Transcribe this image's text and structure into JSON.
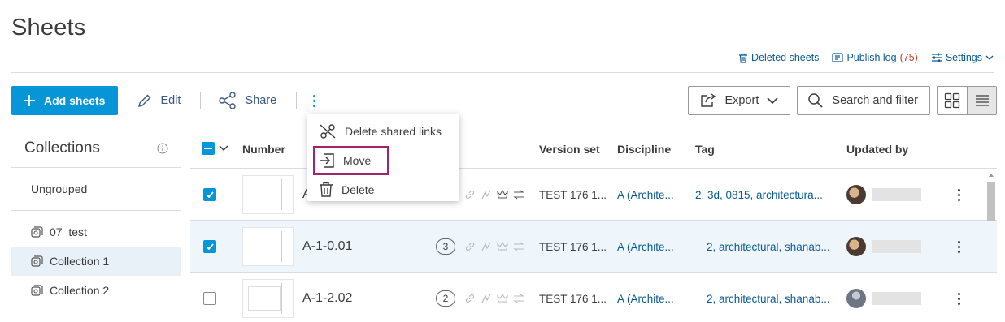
{
  "page_title": "Sheets",
  "top_links": {
    "deleted_sheets": "Deleted sheets",
    "publish_log": "Publish log",
    "publish_log_count": "(75)",
    "settings": "Settings"
  },
  "toolbar": {
    "add_sheets": "Add sheets",
    "edit": "Edit",
    "share": "Share",
    "export": "Export",
    "search_filter": "Search and filter"
  },
  "menu": {
    "items": [
      "Delete shared links",
      "Move",
      "Delete"
    ]
  },
  "collections": {
    "title": "Collections",
    "ungrouped": "Ungrouped",
    "items": [
      "07_test",
      "Collection 1",
      "Collection 2"
    ],
    "active_index": 1
  },
  "table": {
    "headers": {
      "number": "Number",
      "version_set": "Version set",
      "discipline": "Discipline",
      "tag": "Tag",
      "updated_by": "Updated by"
    },
    "rows": [
      {
        "number": "A",
        "version": "",
        "version_set": "TEST 176 1...",
        "discipline": "A (Archite...",
        "tag": "2, 3d, 0815, architectura...",
        "checked": true
      },
      {
        "number": "A-1-0.01",
        "version": "3",
        "version_set": "TEST 176 1...",
        "discipline": "A (Archite...",
        "tag": "2, architectural, shanab...",
        "checked": true
      },
      {
        "number": "A-1-2.02",
        "version": "2",
        "version_set": "TEST 176 1...",
        "discipline": "A (Archite...",
        "tag": "2, architectural, shanab...",
        "checked": false
      }
    ]
  },
  "colors": {
    "accent": "#0696d7",
    "link": "#0a5a96",
    "highlight": "#a3246e",
    "count": "#d03a1f"
  }
}
